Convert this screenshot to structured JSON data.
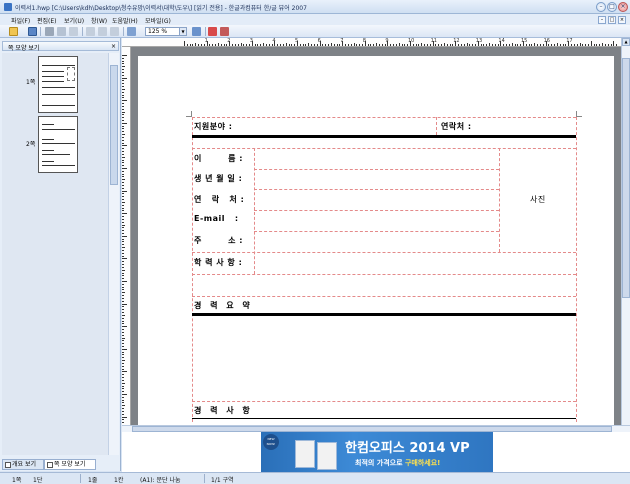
{
  "window": {
    "title": "이력서1.hwp [C:\\Users\\kdh\\Desktop\\청수유망\\이력서\\대학\\도우\\] [읽기 전용] - 한글과컴퓨터 한/글 뷰어 2007",
    "min_btn": "–",
    "max_btn": "□",
    "close_btn": "×"
  },
  "menu": {
    "items": [
      "파일(F)",
      "편집(E)",
      "보기(U)",
      "창(W)",
      "도움말(H)",
      "모바일(G)"
    ],
    "mdi_buttons": [
      "–",
      "□",
      "×"
    ]
  },
  "toolbar": {
    "zoom": "125 %"
  },
  "sidebar": {
    "title": "쪽 모양 보기",
    "close": "×",
    "page_labels": [
      "1쪽",
      "2쪽"
    ],
    "tabs": [
      "개요 보기",
      "쪽 모양 보기"
    ]
  },
  "ruler": {
    "numbers": [
      "1",
      "2",
      "3",
      "4",
      "5",
      "6",
      "7",
      "8",
      "9",
      "10",
      "11",
      "12",
      "13",
      "14",
      "15",
      "16",
      "17"
    ]
  },
  "resume": {
    "field_area": "지원분야 :",
    "contact": "연락처 :",
    "name": "이        름 :",
    "birth": "생 년 월 일 :",
    "phone": "연   락   처 :",
    "email": "E-mail   :",
    "address": "주        소 :",
    "education": "학 력 사 항 :",
    "photo": "사진",
    "career_summary": "경 력 요 약",
    "career_history": "경 력 사 항"
  },
  "ad": {
    "badge": "NEW NOW!",
    "headline": "한컴오피스 2014 VP",
    "sub_plain": "최적의 가격으로 ",
    "sub_highlight": "구매하세요!"
  },
  "status": {
    "page": "1쪽",
    "section": "1단",
    "line": "1줄",
    "col": "1칸",
    "style": "(A1): 문단 나눔",
    "pages": "1/1 구역"
  },
  "colors": {
    "guide_red": "#e26a6a",
    "workspace_gray": "#7e8287",
    "ad_blue": "#2f76c1"
  }
}
